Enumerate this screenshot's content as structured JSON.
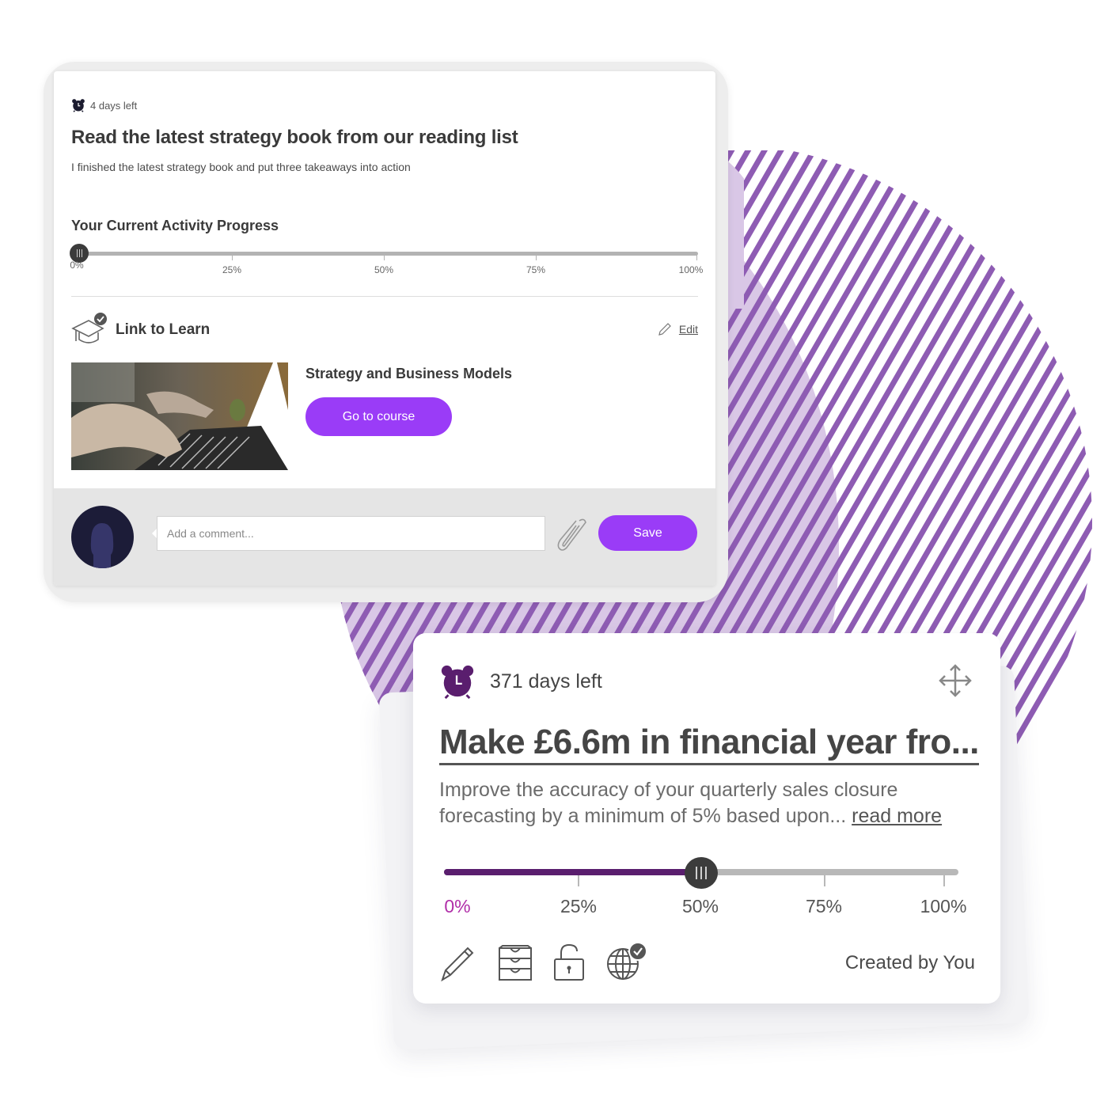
{
  "activity_card": {
    "deadline": "4 days left",
    "title": "Read the latest strategy book from our reading list",
    "description": "I finished the latest strategy book and put three takeaways into action",
    "progress_label": "Your Current Activity Progress",
    "progress_percent": 0,
    "progress_ticks": [
      "0%",
      "25%",
      "50%",
      "75%",
      "100%"
    ],
    "link_to_learn_label": "Link to Learn",
    "edit_label": "Edit",
    "course": {
      "title": "Strategy and Business Models",
      "button_label": "Go to course",
      "image_icon": "laptop-hands-photo"
    },
    "comment": {
      "placeholder": "Add a comment...",
      "value": "",
      "attach_icon": "paperclip-icon",
      "save_label": "Save"
    },
    "accent_color": "#9a3cf7"
  },
  "goal_card": {
    "deadline": "371 days left",
    "title": "Make £6.6m in financial year fro...",
    "description": "Improve the accuracy of your quarterly sales closure forecasting by a minimum of 5% based upon...",
    "read_more_label": "read more",
    "progress_percent": 50,
    "progress_ticks": [
      "0%",
      "25%",
      "50%",
      "75%",
      "100%"
    ],
    "action_icons": [
      "pencil-icon",
      "drawers-icon",
      "unlock-icon",
      "globe-check-icon"
    ],
    "created_by": "Created by You",
    "fill_color": "#5a1e6e",
    "alarm_color": "#5a1e6e"
  }
}
